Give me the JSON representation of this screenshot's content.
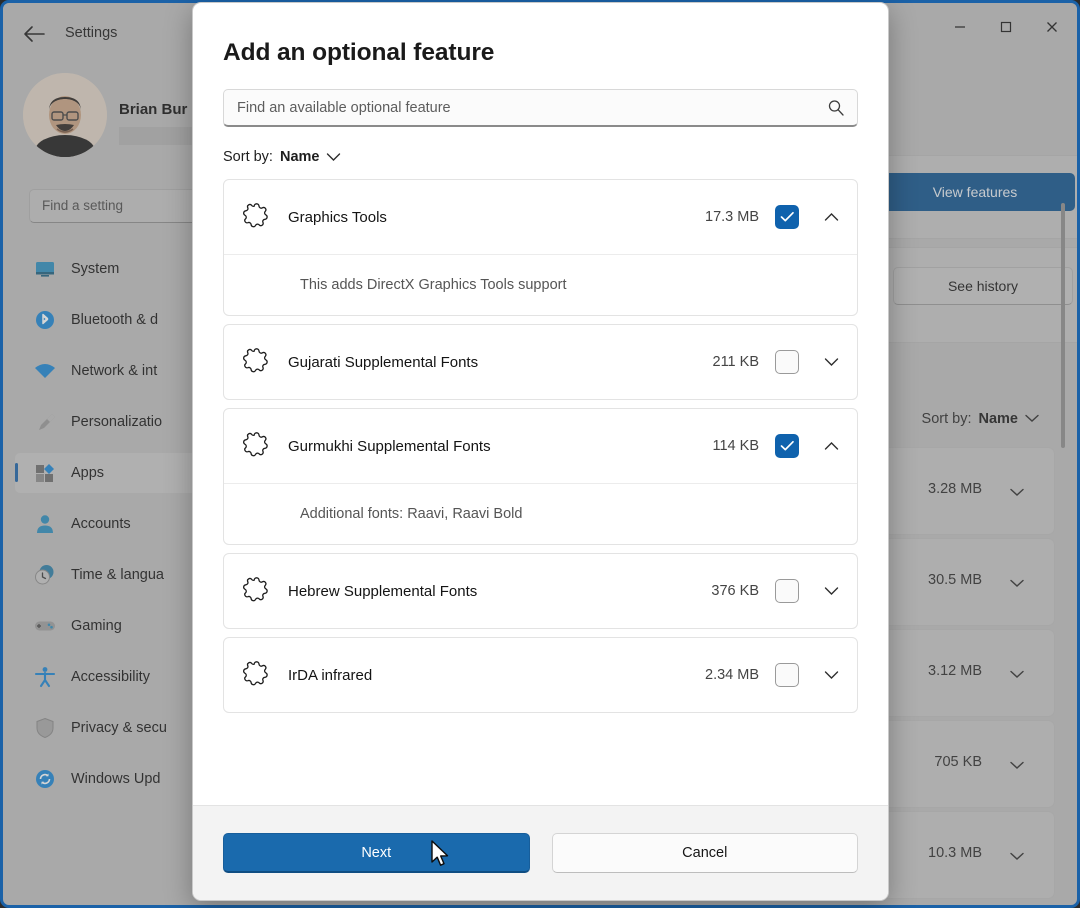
{
  "window": {
    "title": "Settings",
    "back_icon": "back-arrow-icon",
    "controls": [
      {
        "name": "minimize",
        "glyph": "−"
      },
      {
        "name": "maximize",
        "glyph": "□"
      },
      {
        "name": "close",
        "glyph": "✕"
      }
    ]
  },
  "sidebar": {
    "user_name": "Brian Bur",
    "search_placeholder": "Find a setting",
    "items": [
      {
        "label": "System",
        "icon": "monitor-icon",
        "selected": false
      },
      {
        "label": "Bluetooth & d",
        "icon": "bluetooth-icon",
        "selected": false
      },
      {
        "label": "Network & int",
        "icon": "wifi-icon",
        "selected": false
      },
      {
        "label": "Personalizatio",
        "icon": "brush-icon",
        "selected": false
      },
      {
        "label": "Apps",
        "icon": "apps-icon",
        "selected": true
      },
      {
        "label": "Accounts",
        "icon": "person-icon",
        "selected": false
      },
      {
        "label": "Time & langua",
        "icon": "clock-icon",
        "selected": false
      },
      {
        "label": "Gaming",
        "icon": "gamepad-icon",
        "selected": false
      },
      {
        "label": "Accessibility",
        "icon": "accessibility-icon",
        "selected": false
      },
      {
        "label": "Privacy & secu",
        "icon": "shield-icon",
        "selected": false
      },
      {
        "label": "Windows Upd",
        "icon": "update-icon",
        "selected": false
      }
    ]
  },
  "background_content": {
    "view_features_label": "View features",
    "see_history_label": "See history",
    "sort_by_label": "Sort by:",
    "sort_by_value": "Name",
    "rows": [
      {
        "size": "3.28 MB"
      },
      {
        "size": "30.5 MB"
      },
      {
        "size": "3.12 MB"
      },
      {
        "size": "705 KB"
      },
      {
        "size": "10.3 MB"
      }
    ]
  },
  "dialog": {
    "title": "Add an optional feature",
    "search_placeholder": "Find an available optional feature",
    "search_icon": "search-icon",
    "sort_by_label": "Sort by:",
    "sort_by_value": "Name",
    "features": [
      {
        "name": "Graphics Tools",
        "size": "17.3 MB",
        "checked": true,
        "expanded": true,
        "description": "This adds DirectX Graphics Tools support"
      },
      {
        "name": "Gujarati Supplemental Fonts",
        "size": "211 KB",
        "checked": false,
        "expanded": false,
        "description": ""
      },
      {
        "name": "Gurmukhi Supplemental Fonts",
        "size": "114 KB",
        "checked": true,
        "expanded": true,
        "description": "Additional fonts: Raavi, Raavi Bold"
      },
      {
        "name": "Hebrew Supplemental Fonts",
        "size": "376 KB",
        "checked": false,
        "expanded": false,
        "description": ""
      },
      {
        "name": "IrDA infrared",
        "size": "2.34 MB",
        "checked": false,
        "expanded": false,
        "description": ""
      }
    ],
    "next_label": "Next",
    "cancel_label": "Cancel"
  },
  "colors": {
    "accent": "#1a6aad",
    "accent_dark": "#11538f",
    "checkbox_on": "#0f62ad",
    "window_border": "#1b62a8"
  }
}
